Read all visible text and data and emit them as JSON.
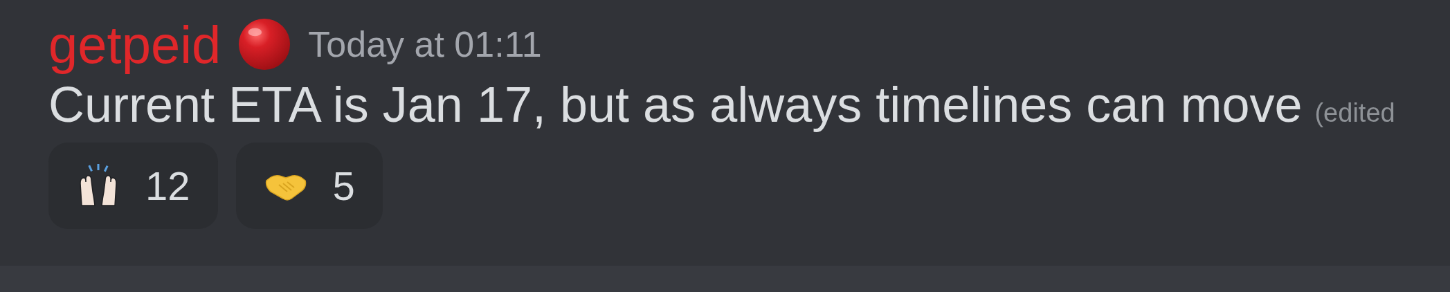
{
  "message": {
    "author": "getpeid",
    "timestamp": "Today at 01:11",
    "text": "Current ETA is Jan 17, but as always timelines can move",
    "edited_label": "(edited"
  },
  "reactions": [
    {
      "count": "12"
    },
    {
      "count": "5"
    }
  ]
}
